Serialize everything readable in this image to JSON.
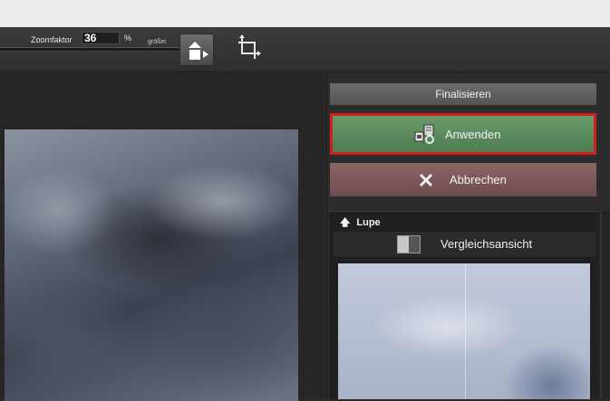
{
  "toolbar": {
    "zoom_label": "Zoomfaktor",
    "zoom_value": "36",
    "zoom_unit": "%",
    "bigger_label": "größer"
  },
  "panel": {
    "finalize_title": "Finalisieren",
    "apply_label": "Anwenden",
    "cancel_label": "Abbrechen",
    "apply_highlight_color": "#d11f1f",
    "apply_bg_color": "#5e8c60",
    "cancel_bg_color": "#7b585a"
  },
  "lupe": {
    "header": "Lupe",
    "compare_label": "Vergleichsansicht"
  },
  "icons": {
    "zoom_in": "zoom-in-arrow-icon",
    "crop": "crop-rotate-icon",
    "apply": "apply-document-icon",
    "cancel": "close-x-icon",
    "lupe": "arrow-up-icon",
    "compare": "split-compare-icon"
  }
}
